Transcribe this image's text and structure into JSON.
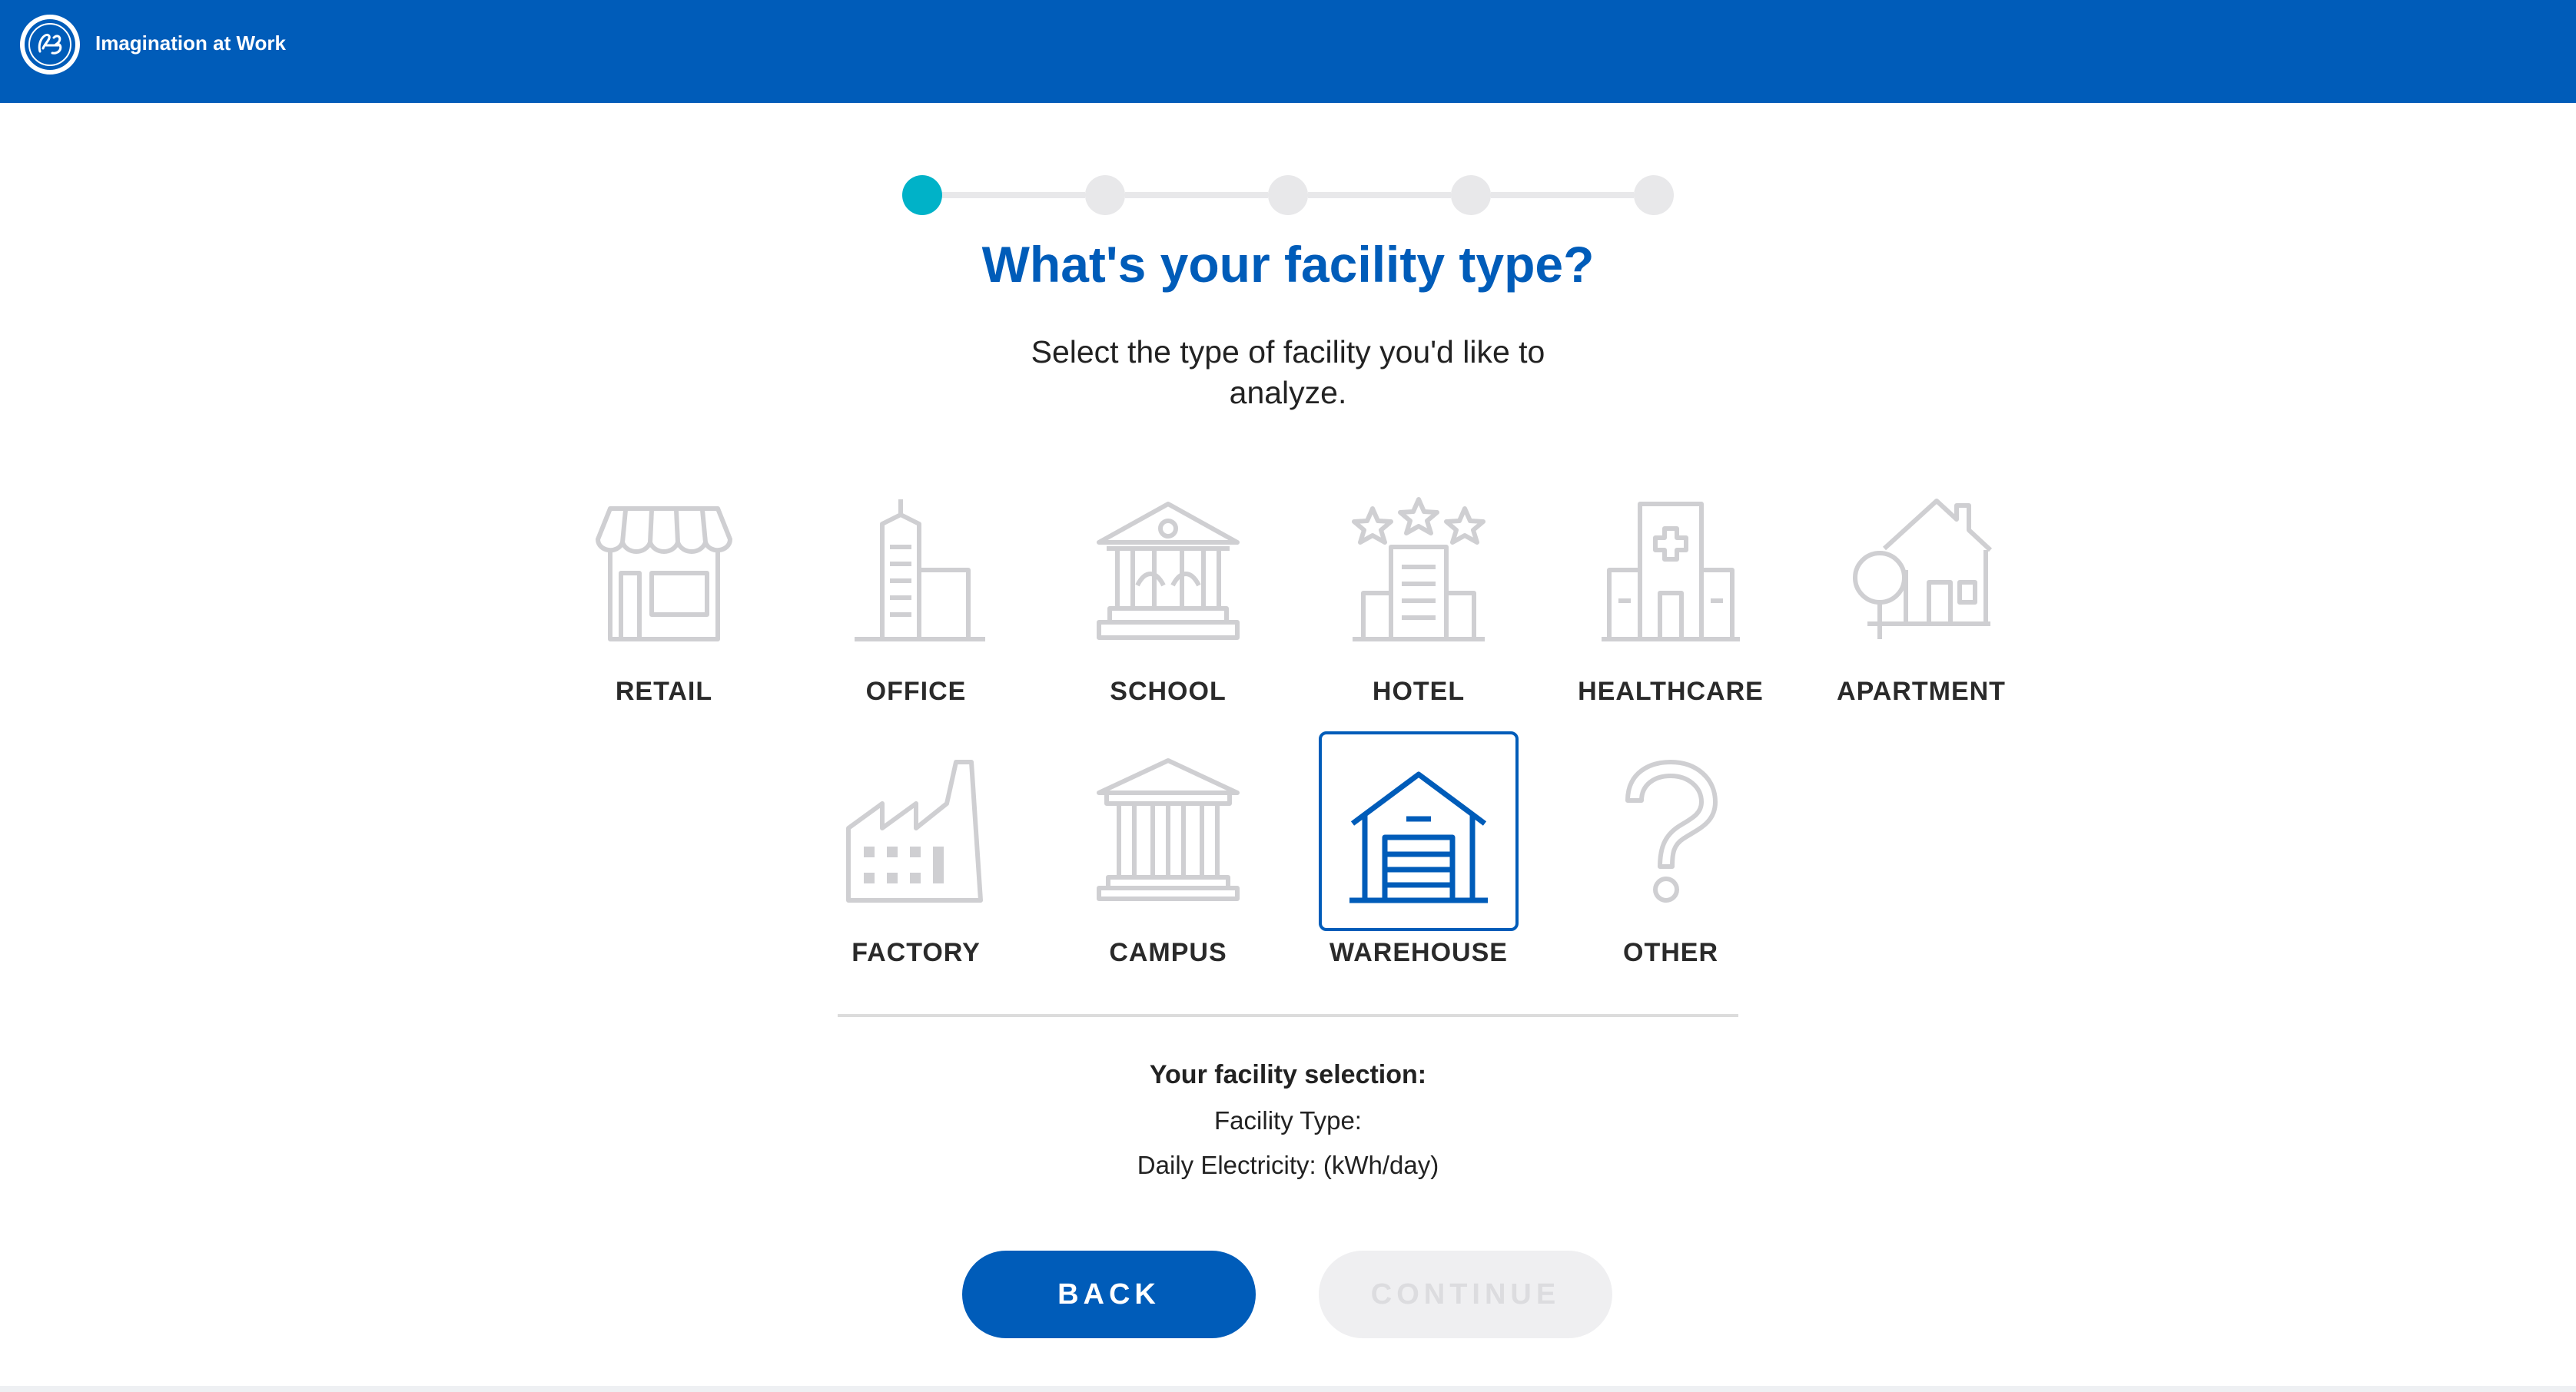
{
  "header": {
    "tagline": "Imagination at Work",
    "logo_icon": "ge-monogram-icon",
    "background_color": "#005cb9"
  },
  "stepper": {
    "total_steps": 5,
    "current_step": 1,
    "active_color": "#00b2c8",
    "inactive_color": "#e8e8ea"
  },
  "heading": {
    "title": "What's your facility type?",
    "subtitle": "Select the type of facility you'd like to analyze."
  },
  "facilities": [
    {
      "label": "RETAIL",
      "icon": "storefront-icon",
      "selected": false
    },
    {
      "label": "OFFICE",
      "icon": "office-building-icon",
      "selected": false
    },
    {
      "label": "SCHOOL",
      "icon": "school-building-icon",
      "selected": false
    },
    {
      "label": "HOTEL",
      "icon": "hotel-stars-icon",
      "selected": false
    },
    {
      "label": "HEALTHCARE",
      "icon": "hospital-icon",
      "selected": false
    },
    {
      "label": "APARTMENT",
      "icon": "house-tree-icon",
      "selected": false
    },
    {
      "label": "FACTORY",
      "icon": "factory-icon",
      "selected": false
    },
    {
      "label": "CAMPUS",
      "icon": "columned-building-icon",
      "selected": false
    },
    {
      "label": "WAREHOUSE",
      "icon": "warehouse-icon",
      "selected": true
    },
    {
      "label": "OTHER",
      "icon": "question-mark-icon",
      "selected": false
    }
  ],
  "summary": {
    "title": "Your facility selection:",
    "facility_type_label": "Facility Type:",
    "daily_electricity_label": "Daily Electricity:  (kWh/day)"
  },
  "buttons": {
    "back_label": "BACK",
    "continue_label": "CONTINUE",
    "continue_enabled": false
  },
  "colors": {
    "brand_blue": "#005cb9",
    "icon_inactive": "#cfcfd2",
    "icon_selected": "#005cb9"
  }
}
